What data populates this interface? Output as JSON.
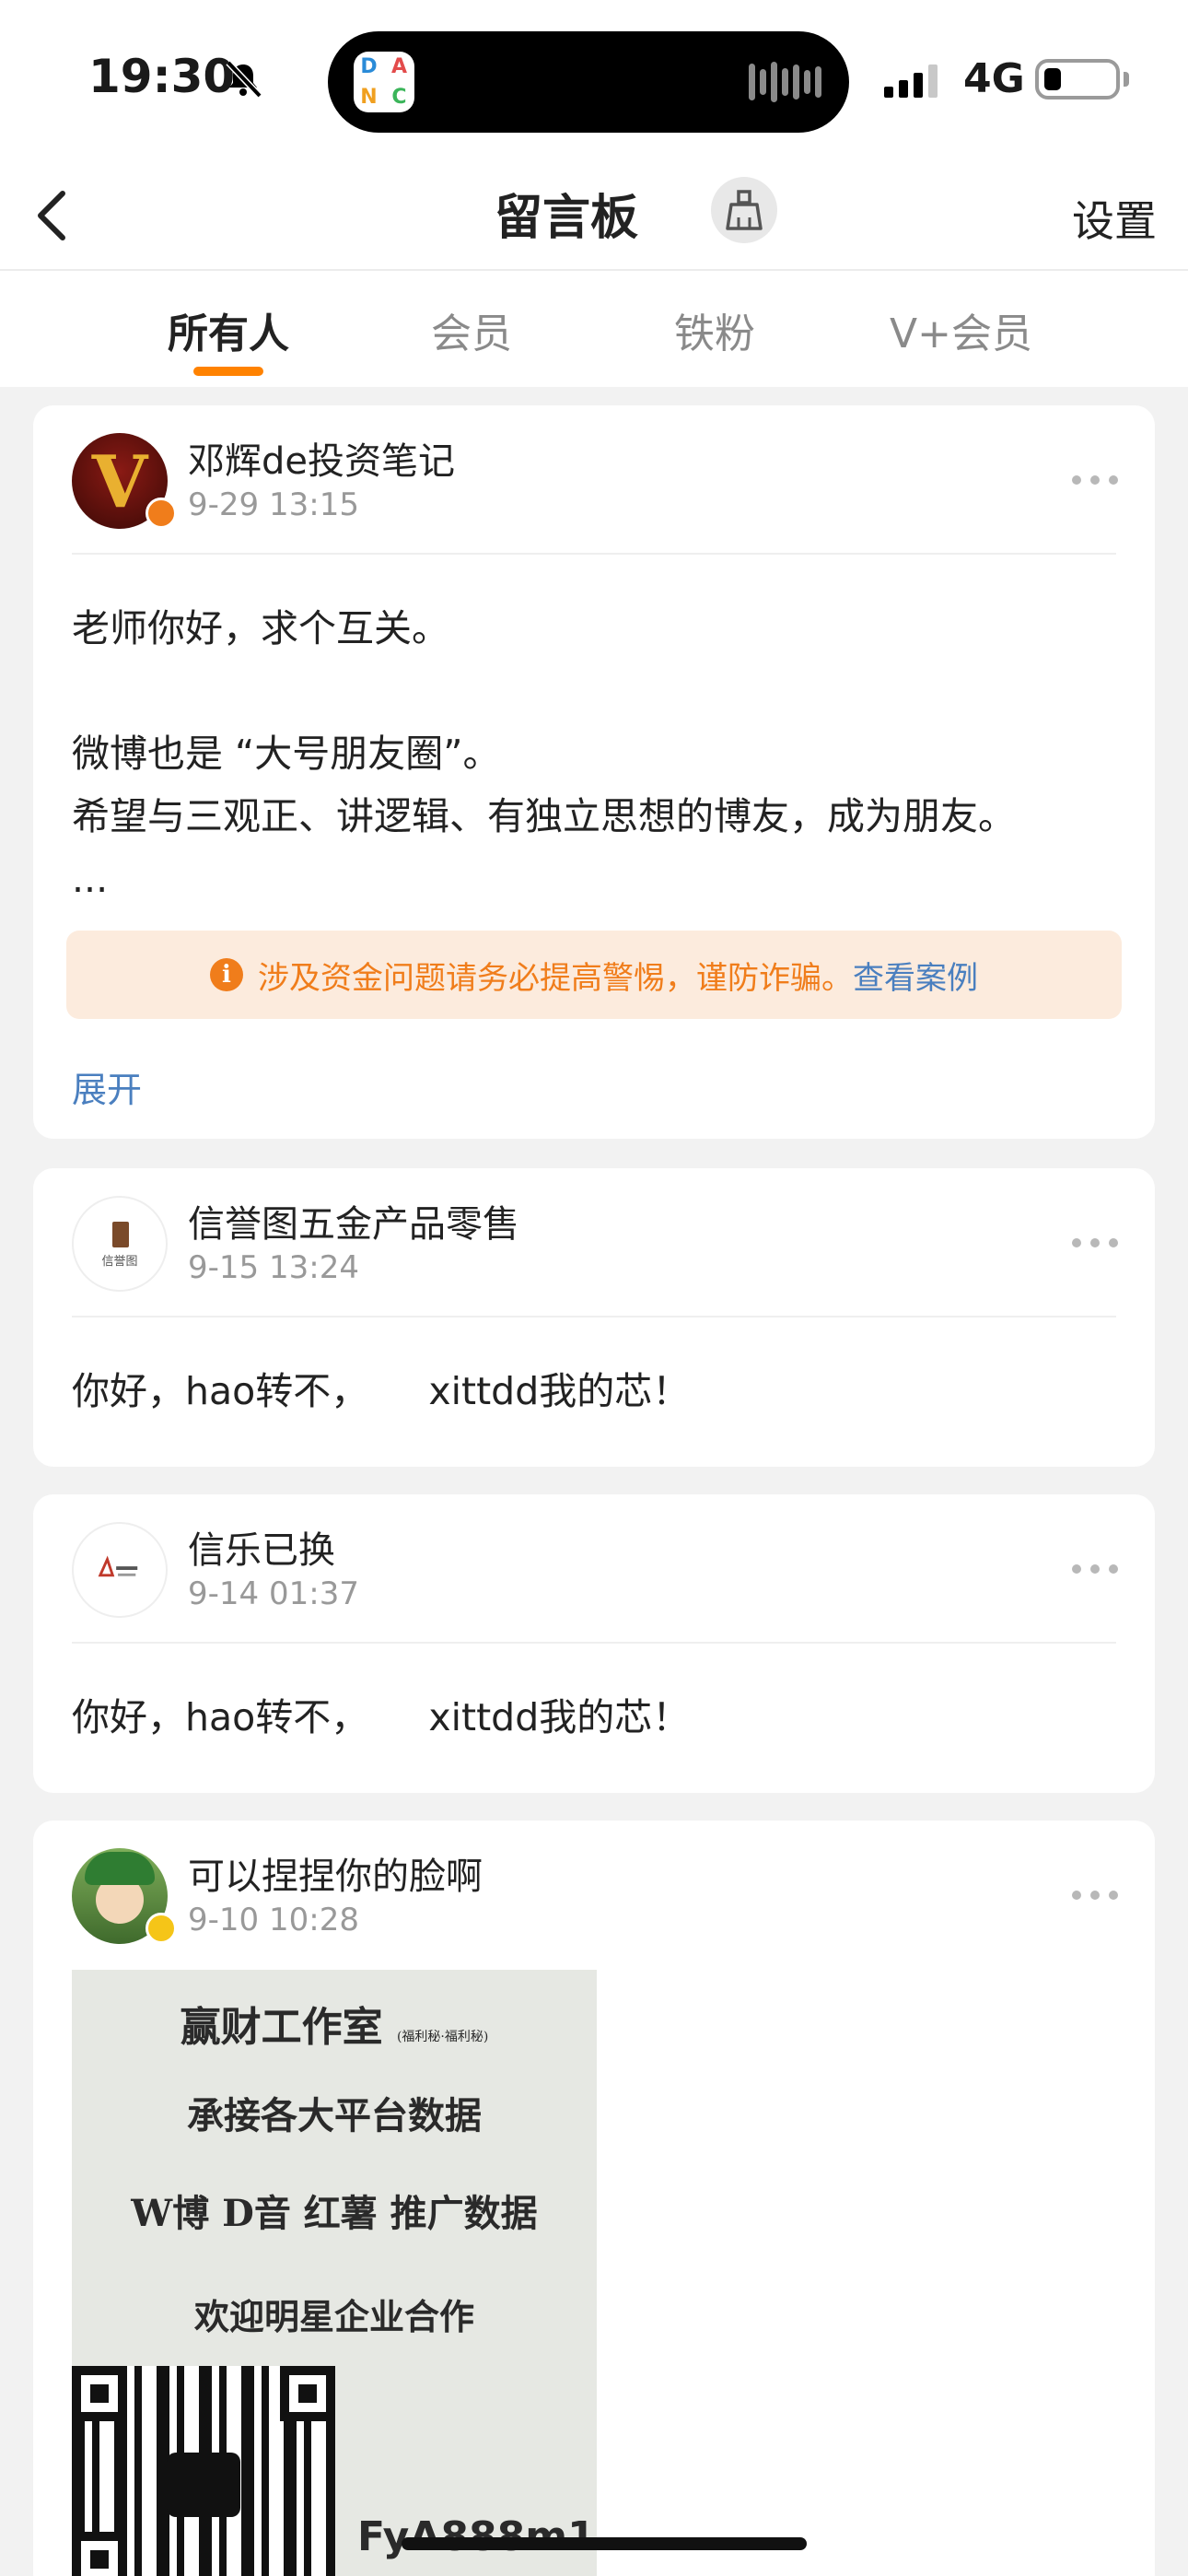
{
  "status_bar": {
    "time": "19:30",
    "network": "4G",
    "island_app_letters": [
      "D",
      "A",
      "N",
      "C"
    ],
    "icons": [
      "bell-off-icon",
      "signal-icon",
      "battery-icon"
    ]
  },
  "nav": {
    "title": "留言板",
    "settings_label": "设置",
    "icons": [
      "back-arrow-icon",
      "broom-icon"
    ]
  },
  "tabs": [
    {
      "label": "所有人",
      "active": true
    },
    {
      "label": "会员",
      "active": false
    },
    {
      "label": "铁粉",
      "active": false
    },
    {
      "label": "V+会员",
      "active": false
    }
  ],
  "accent_color": "#ff8200",
  "messages": [
    {
      "user": "邓辉de投资笔记",
      "time": "9-29 13:15",
      "text": "老师你好，求个互关。\n\n微博也是 “大号朋友圈”。\n希望与三观正、讲逻辑、有独立思想的博友，成为朋友。\n...",
      "warning": "涉及资金问题请务必提高警惕，谨防诈骗。",
      "warning_link": "查看案例",
      "expand_label": "展开",
      "avatar_letter": "V",
      "verified": true
    },
    {
      "user": "信誉图五金产品零售",
      "time": "9-15 13:24",
      "text": "你好，hao转不，     xittdd我的芯！",
      "avatar_caption": "信誉图"
    },
    {
      "user": "信乐已换",
      "time": "9-14 01:37",
      "text": "你好，hao转不，     xittdd我的芯！"
    },
    {
      "user": "可以捏捏你的脸啊",
      "time": "9-10 10:28",
      "verified": true,
      "image": {
        "line1": "赢财工作室",
        "line1_small": "(福利秘·福利秘)",
        "line2": "承接各大平台数据",
        "line3": "W博  D音  红薯  推广数据",
        "line4": "欢迎明星企业合作",
        "wechat_id": "FyA888m1"
      }
    }
  ]
}
